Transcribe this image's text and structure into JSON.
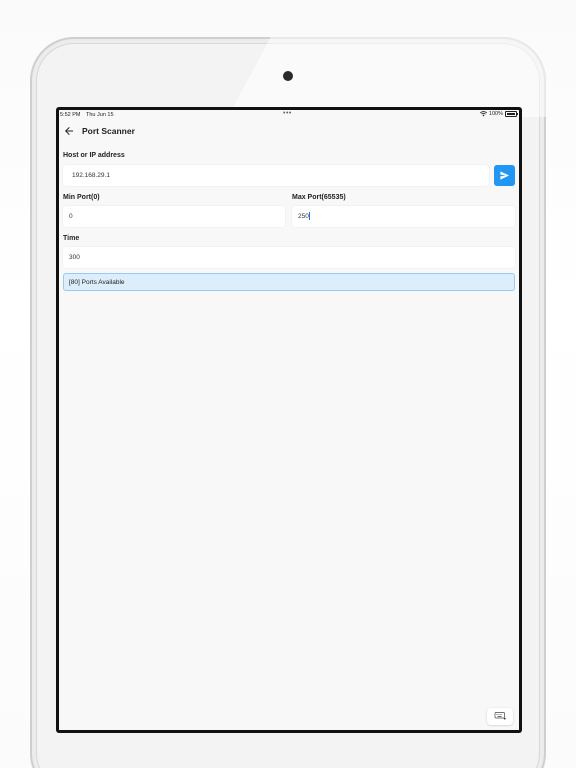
{
  "status_bar": {
    "time": "5:52 PM",
    "date": "Thu Jun 15",
    "dots": "•••",
    "battery": "100%",
    "icons": [
      "wifi-icon",
      "battery-icon"
    ]
  },
  "app_bar": {
    "title": "Port Scanner",
    "back_icon": "arrow-left-icon"
  },
  "form": {
    "host_label": "Host or IP address",
    "host_value": "192.168.29.1",
    "send_icon": "send-icon",
    "min_port_label": "Min Port(0)",
    "min_port_value": "0",
    "max_port_label": "Max Port(65535)",
    "max_port_value": "250",
    "time_label": "Time",
    "time_value": "300"
  },
  "result": {
    "text": "[80] Ports Available"
  },
  "floating": {
    "keyboard_icon": "keyboard-hide-icon"
  },
  "colors": {
    "accent": "#2196f3",
    "banner_bg": "#dceefb",
    "banner_border": "#9cc9ee",
    "screen_bg": "#f8f8f8"
  }
}
